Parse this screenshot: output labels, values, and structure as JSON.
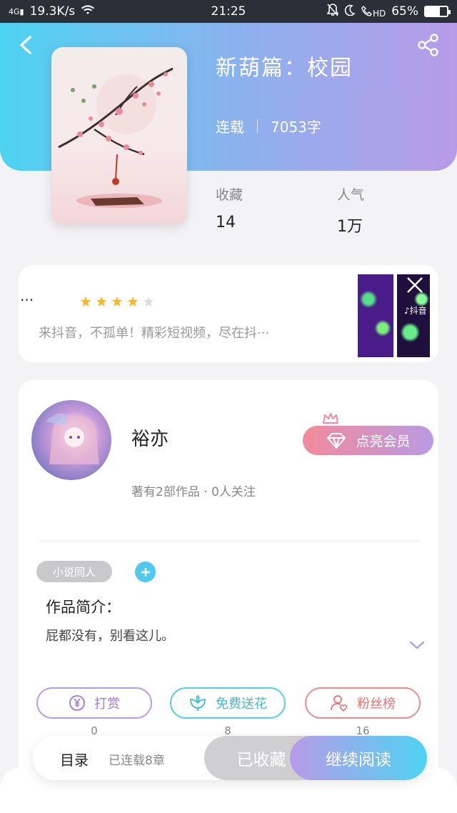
{
  "status_bar": {
    "signal": "4G",
    "speed": "19.3K/s",
    "time": "21:25",
    "hd": "HD",
    "battery": "65%",
    "battery_level": 0.65
  },
  "book": {
    "title": "新葫篇：校园",
    "status": "连载",
    "word_count": "7053字",
    "favorites_label": "收藏",
    "favorites_value": "14",
    "popularity_label": "人气",
    "popularity_value": "1万"
  },
  "ad": {
    "dots": "···",
    "rating": 4,
    "text": "来抖音，不孤单！精彩短视频，尽在抖···",
    "brand": "抖音"
  },
  "author": {
    "name": "裕亦",
    "vip_label": "点亮会员",
    "summary": "著有2部作品 · 0人关注"
  },
  "tags": [
    {
      "label": "小说同人"
    }
  ],
  "intro": {
    "title": "作品简介：",
    "text": "屁都没有，别看这儿。"
  },
  "actions": [
    {
      "label": "打赏",
      "count": "0"
    },
    {
      "label": "免费送花",
      "count": "8"
    },
    {
      "label": "粉丝榜",
      "count": "16"
    }
  ],
  "bottom": {
    "toc_label": "目录",
    "toc_sub": "已连载8章",
    "fav_label": "已收藏",
    "read_label": "继续阅读"
  },
  "colors": {
    "header_start": "#4dd3f2",
    "header_end": "#b89be8",
    "vip_start": "#f38a9b",
    "vip_end": "#b99ae3"
  }
}
